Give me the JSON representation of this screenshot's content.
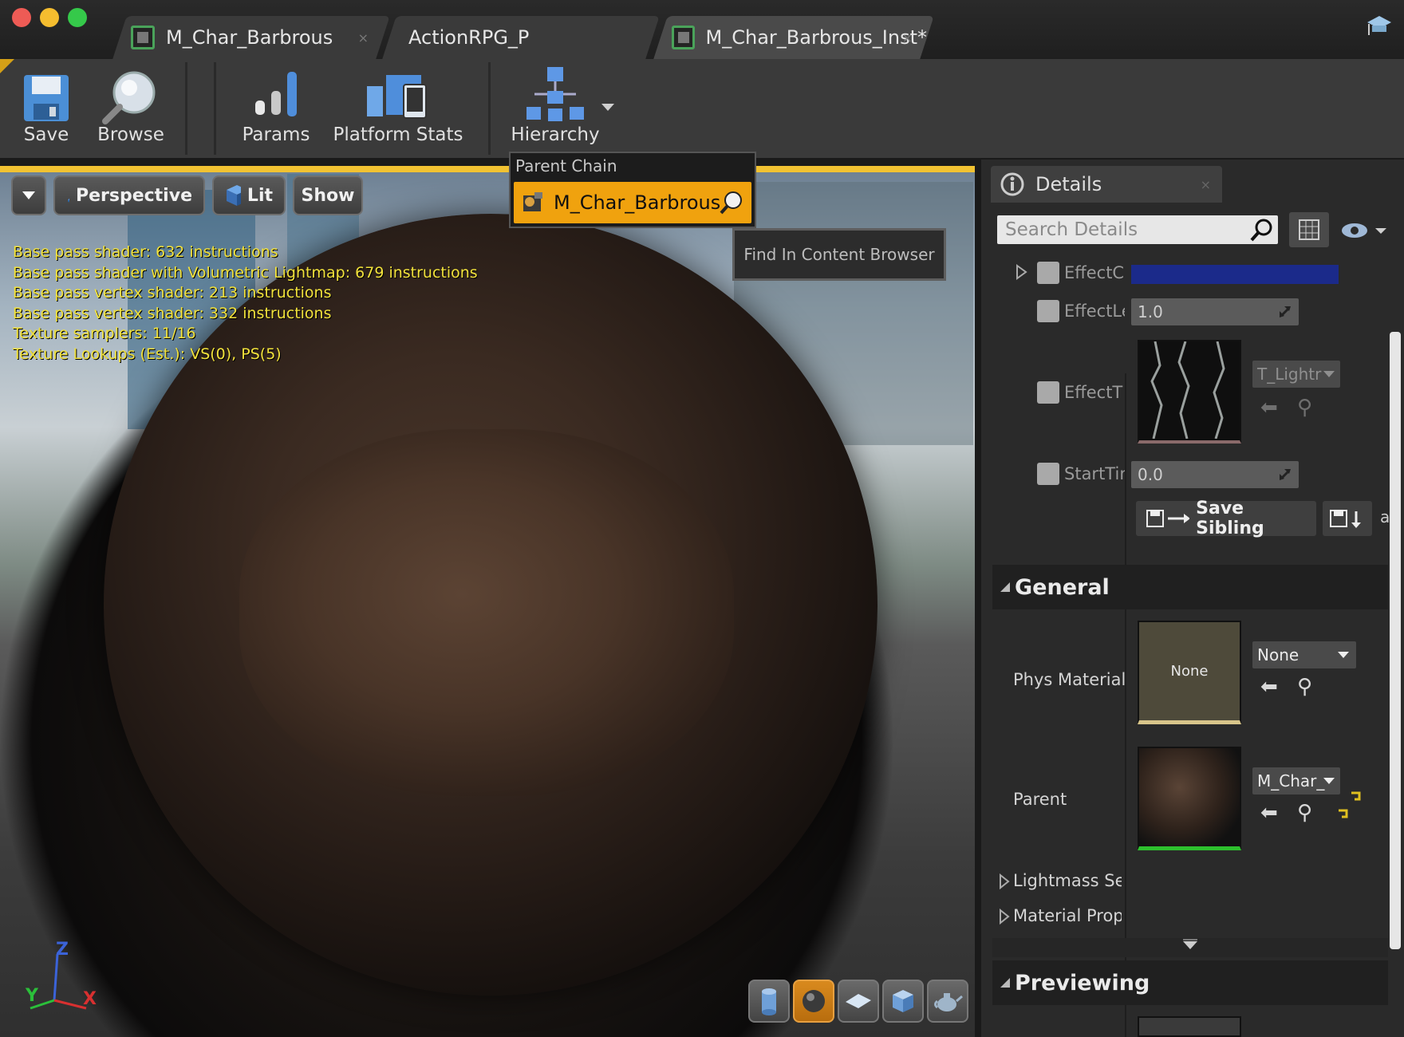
{
  "window": {
    "tabs": [
      {
        "label": "M_Char_Barbrous",
        "close": "×"
      },
      {
        "label": "ActionRPG_P"
      },
      {
        "label": "M_Char_Barbrous_Inst*",
        "close": "×"
      }
    ]
  },
  "toolbar": {
    "save": "Save",
    "browse": "Browse",
    "params": "Params",
    "platform_stats": "Platform Stats",
    "hierarchy": "Hierarchy"
  },
  "viewport": {
    "perspective": "Perspective",
    "lit": "Lit",
    "show": "Show",
    "stats": [
      "Base pass shader: 632 instructions",
      "Base pass shader with Volumetric Lightmap: 679 instructions",
      "Base pass vertex shader: 213 instructions",
      "Base pass vertex shader: 332 instructions",
      "Texture samplers: 11/16",
      "Texture Lookups (Est.): VS(0), PS(5)"
    ],
    "axes": {
      "z": "Z",
      "y": "Y",
      "x": "X"
    }
  },
  "popup": {
    "header": "Parent Chain",
    "item": "M_Char_Barbrous",
    "tooltip": "Find In Content Browser"
  },
  "details": {
    "tab": "Details",
    "tab_close": "×",
    "search_placeholder": "Search Details",
    "props": {
      "effect_color": "EffectC",
      "effect_length": "EffectLe",
      "effect_length_value": "1.0",
      "effect_texture": "EffectT",
      "effect_texture_name": "T_Lightr",
      "start_time": "StartTin",
      "start_time_value": "0.0"
    },
    "save_sibling": "Save Sibling",
    "save_child_fragment": "a",
    "general": {
      "title": "General",
      "phys_material": "Phys Material",
      "phys_thumb": "None",
      "phys_combo": "None",
      "parent": "Parent",
      "parent_combo": "M_Char_",
      "lightmass": "Lightmass Se",
      "material_prop": "Material Prop"
    },
    "previewing": "Previewing"
  },
  "colors": {
    "accent_orange": "#f0a20e",
    "stats_yellow": "#f2e23b",
    "effect_color_swatch": "#1b2a8a"
  }
}
